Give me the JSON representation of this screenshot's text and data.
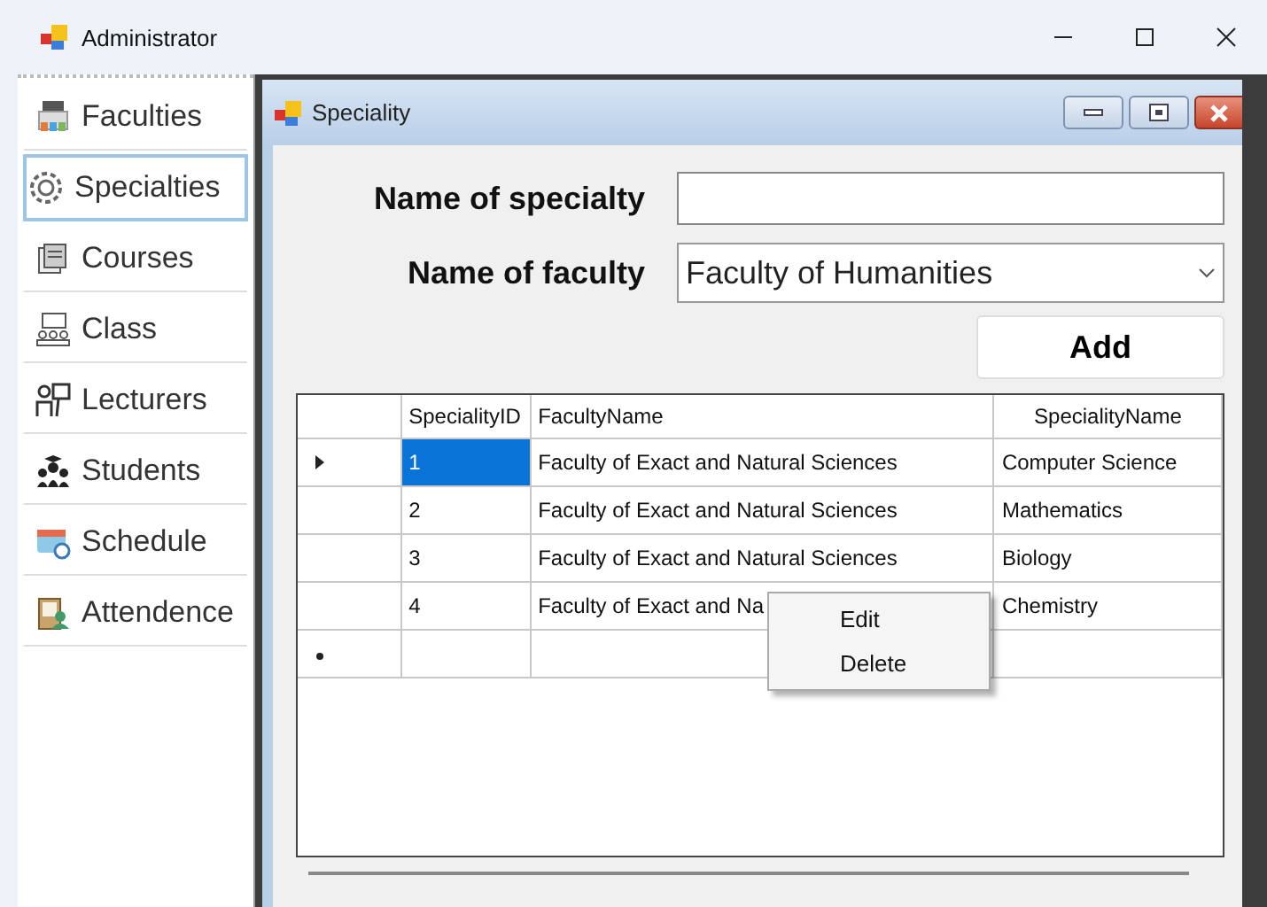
{
  "window": {
    "title": "Administrator"
  },
  "sidebar": {
    "items": [
      {
        "label": "Faculties",
        "selected": false
      },
      {
        "label": "Specialties",
        "selected": true
      },
      {
        "label": "Courses",
        "selected": false
      },
      {
        "label": "Class",
        "selected": false
      },
      {
        "label": "Lecturers",
        "selected": false
      },
      {
        "label": "Students",
        "selected": false
      },
      {
        "label": "Schedule",
        "selected": false
      },
      {
        "label": "Attendence",
        "selected": false
      }
    ]
  },
  "child_window": {
    "title": "Speciality",
    "form": {
      "specialty_label": "Name of specialty",
      "faculty_label": "Name of faculty",
      "faculty_value": "Faculty of Humanities",
      "add_button": "Add"
    },
    "table": {
      "columns": [
        "SpecialityID",
        "FacultyName",
        "SpecialityName"
      ],
      "rows": [
        {
          "current": true,
          "cells": [
            {
              "text": "1",
              "selected": true
            },
            {
              "text": "Faculty of Exact and Natural Sciences",
              "selected": false
            },
            {
              "text": "Computer Science",
              "selected": false
            }
          ]
        },
        {
          "current": false,
          "cells": [
            {
              "text": "2",
              "selected": false
            },
            {
              "text": "Faculty of Exact and Natural Sciences",
              "selected": false
            },
            {
              "text": "Mathematics",
              "selected": false
            }
          ]
        },
        {
          "current": false,
          "cells": [
            {
              "text": "3",
              "selected": false
            },
            {
              "text": "Faculty of Exact and Natural Sciences",
              "selected": false
            },
            {
              "text": "Biology",
              "selected": false
            }
          ]
        },
        {
          "current": false,
          "cells": [
            {
              "text": "4",
              "selected": false
            },
            {
              "text": "Faculty of Exact and Na",
              "selected": false
            },
            {
              "text": "Chemistry",
              "selected": false
            }
          ]
        }
      ],
      "new_row": true
    },
    "context_menu": {
      "items": [
        "Edit",
        "Delete"
      ]
    }
  }
}
